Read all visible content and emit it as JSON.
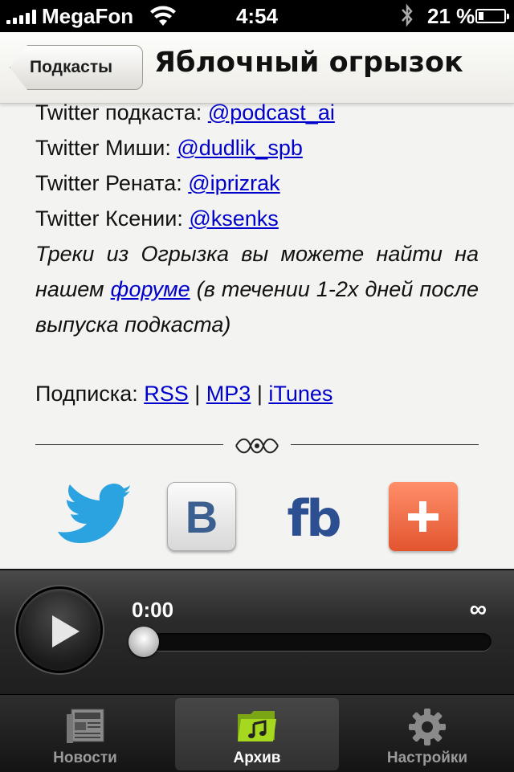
{
  "status_bar": {
    "carrier": "MegaFon",
    "time": "4:54",
    "battery": "21 %",
    "battery_level": 0.21
  },
  "nav": {
    "back_label": "Подкасты",
    "title": "Яблочный огрызок"
  },
  "content": {
    "lines": [
      {
        "label": "Twitter подкаста: ",
        "link": "@podcast_ai"
      },
      {
        "label": "Twitter Миши: ",
        "link": "@dudlik_spb"
      },
      {
        "label": "Twitter Рената: ",
        "link": "@iprizrak"
      },
      {
        "label": "Twitter Ксении: ",
        "link": "@ksenks"
      }
    ],
    "italic_before": "Треки из Огрызка вы можете найти на нашем ",
    "italic_link": "форуме",
    "italic_after": " (в течении 1-2х дней после выпуска подкаста)",
    "subscribe_label": "Подписка: ",
    "subscribe_links": [
      "RSS",
      "MP3",
      "iTunes"
    ],
    "separator": " | "
  },
  "social": {
    "vk_letter": "B",
    "fb_text": "fb",
    "icons": [
      "twitter-bird-icon",
      "vk-icon",
      "facebook-icon",
      "share-plus-icon"
    ]
  },
  "player": {
    "current_time": "0:00",
    "total_time": "∞",
    "progress": 0.0
  },
  "tabs": [
    {
      "label": "Новости",
      "icon": "news-icon",
      "active": false
    },
    {
      "label": "Архив",
      "icon": "music-folder-icon",
      "active": true
    },
    {
      "label": "Настройки",
      "icon": "gear-icon",
      "active": false
    }
  ],
  "colors": {
    "link": "#0000cc",
    "plus_button": "#f0663e",
    "vk": "#3b5f8e",
    "facebook": "#2c4f91",
    "twitter": "#2aa3e0",
    "archive_icon": "#9ccc1e"
  }
}
